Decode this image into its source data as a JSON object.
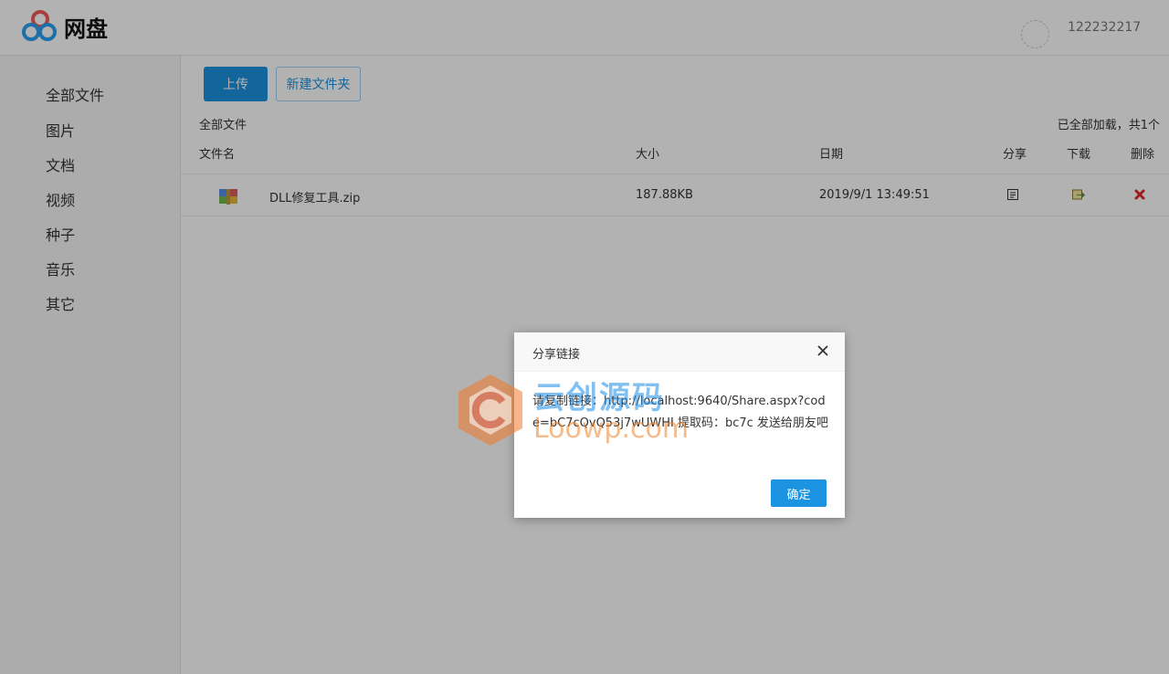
{
  "header": {
    "logo_text": "网盘",
    "username": "122232217"
  },
  "sidebar": {
    "items": [
      {
        "label": "全部文件"
      },
      {
        "label": "图片"
      },
      {
        "label": "文档"
      },
      {
        "label": "视频"
      },
      {
        "label": "种子"
      },
      {
        "label": "音乐"
      },
      {
        "label": "其它"
      }
    ]
  },
  "toolbar": {
    "upload_label": "上传",
    "new_folder_label": "新建文件夹"
  },
  "breadcrumb": "全部文件",
  "load_status": "已全部加载，共1个",
  "table": {
    "headers": {
      "name": "文件名",
      "size": "大小",
      "date": "日期",
      "share": "分享",
      "download": "下载",
      "delete": "删除"
    },
    "rows": [
      {
        "name": "DLL修复工具.zip",
        "size": "187.88KB",
        "date": "2019/9/1 13:49:51"
      }
    ]
  },
  "dialog": {
    "title": "分享链接",
    "message": "请复制链接：http://localhost:9640/Share.aspx?code=bC7cQvQ53j7wUWHI 提取码：bc7c 发送给朋友吧",
    "ok_label": "确定"
  },
  "watermark": {
    "line1": "云创源码",
    "line2": "Loowp.com"
  },
  "colors": {
    "primary": "#1b93e0",
    "delete": "#e02a2a"
  }
}
